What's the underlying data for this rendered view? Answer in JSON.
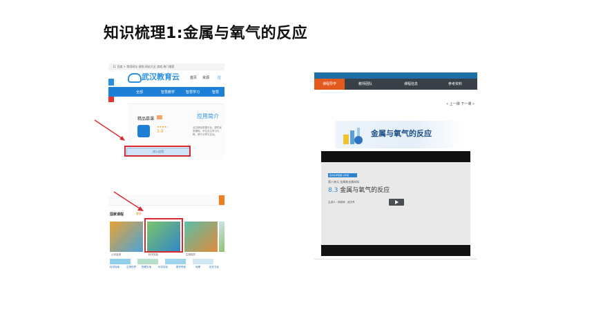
{
  "slide": {
    "title": "知识梳理1:金属与氧气的反应"
  },
  "screenshot_1": {
    "topbar_text": "11  百度 > 常用网址 视频 网站大全 游戏 热门搜索",
    "logo_text": "武汉教育云",
    "nav": [
      "首页",
      "资源",
      "应"
    ],
    "blue_nav": [
      "全部",
      "智慧教学",
      "智慧学习",
      "智慧"
    ],
    "card_title": "精品慕课",
    "intro_label": "应用简介",
    "rating_value": "3.9",
    "rating_badge": "优秀",
    "description": "武汉精品慕课平台，提供优质课程，学生自主学习与教，便于分享与互动。",
    "enter_button": "进入应用"
  },
  "screenshot_2": {
    "section_title": "国家课程",
    "section_tag": "更多",
    "tiles": [
      {
        "caption": "认识自然",
        "colors": [
          "#e8a335",
          "#4aa3d9"
        ]
      },
      {
        "caption": "科学实验",
        "colors": [
          "#7cc46a",
          "#2f86c8"
        ]
      },
      {
        "caption": "生物探究",
        "colors": [
          "#59c0a8",
          "#e28a3a"
        ]
      },
      {
        "caption": "地球",
        "colors": [
          "#cfe4f0",
          "#8bbf6a"
        ]
      }
    ],
    "bottom_labels": [
      "科学探索",
      "生物世界",
      "物理天地",
      "化学实验",
      "数学思维",
      "地理",
      "历史文化"
    ]
  },
  "screenshot_3": {
    "tabs": [
      "课程导学",
      "教师团队",
      "课程信息",
      "参考资料"
    ],
    "active_tab": "课程导学",
    "pager": "« 上一课  下一课 »",
    "banner_title": "金属与氧气的反应",
    "video_tag": "初中化学微课 九年级",
    "video_subtitle": "第八单元 金属和金属材料",
    "chapter_number": "8.3",
    "chapter_title": "金属与氧气的反应",
    "video_meta": "主讲人：徐老师 · 武汉市"
  },
  "colors": {
    "annotation_red": "#d8282f",
    "brand_blue": "#1e7fd6",
    "tab_orange": "#e35a1d"
  }
}
